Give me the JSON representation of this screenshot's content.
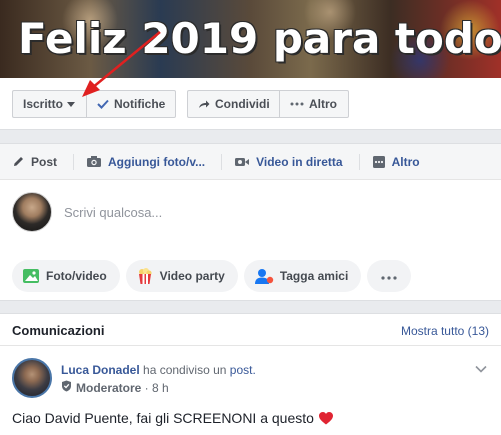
{
  "cover": {
    "title_text": "Feliz 2019 para todo"
  },
  "actions": {
    "subscribed_label": "Iscritto",
    "notifications_label": "Notifiche",
    "share_label": "Condividi",
    "more_label": "Altro"
  },
  "composer": {
    "tabs": [
      {
        "label": "Post",
        "icon": "pencil-icon"
      },
      {
        "label": "Aggiungi foto/v...",
        "icon": "camera-icon"
      },
      {
        "label": "Video in diretta",
        "icon": "video-camera-icon"
      },
      {
        "label": "Altro",
        "icon": "more-grid-icon"
      }
    ],
    "placeholder": "Scrivi qualcosa...",
    "pills": [
      {
        "label": "Foto/video",
        "icon": "photo-icon"
      },
      {
        "label": "Video party",
        "icon": "popcorn-icon"
      },
      {
        "label": "Tagga amici",
        "icon": "tag-friends-icon"
      }
    ]
  },
  "announcements": {
    "title": "Comunicazioni",
    "show_all": "Mostra tutto (13)",
    "post": {
      "author": "Luca Donadel",
      "action_text": "ha condiviso un",
      "object_link": "post.",
      "role": "Moderatore",
      "time": "8 h",
      "body": "Ciao David Puente, fai gli SCREENONI a questo"
    }
  },
  "colors": {
    "link": "#385898",
    "arrow": "#e02020",
    "heart": "#e02432",
    "background": "#e9ebee"
  }
}
